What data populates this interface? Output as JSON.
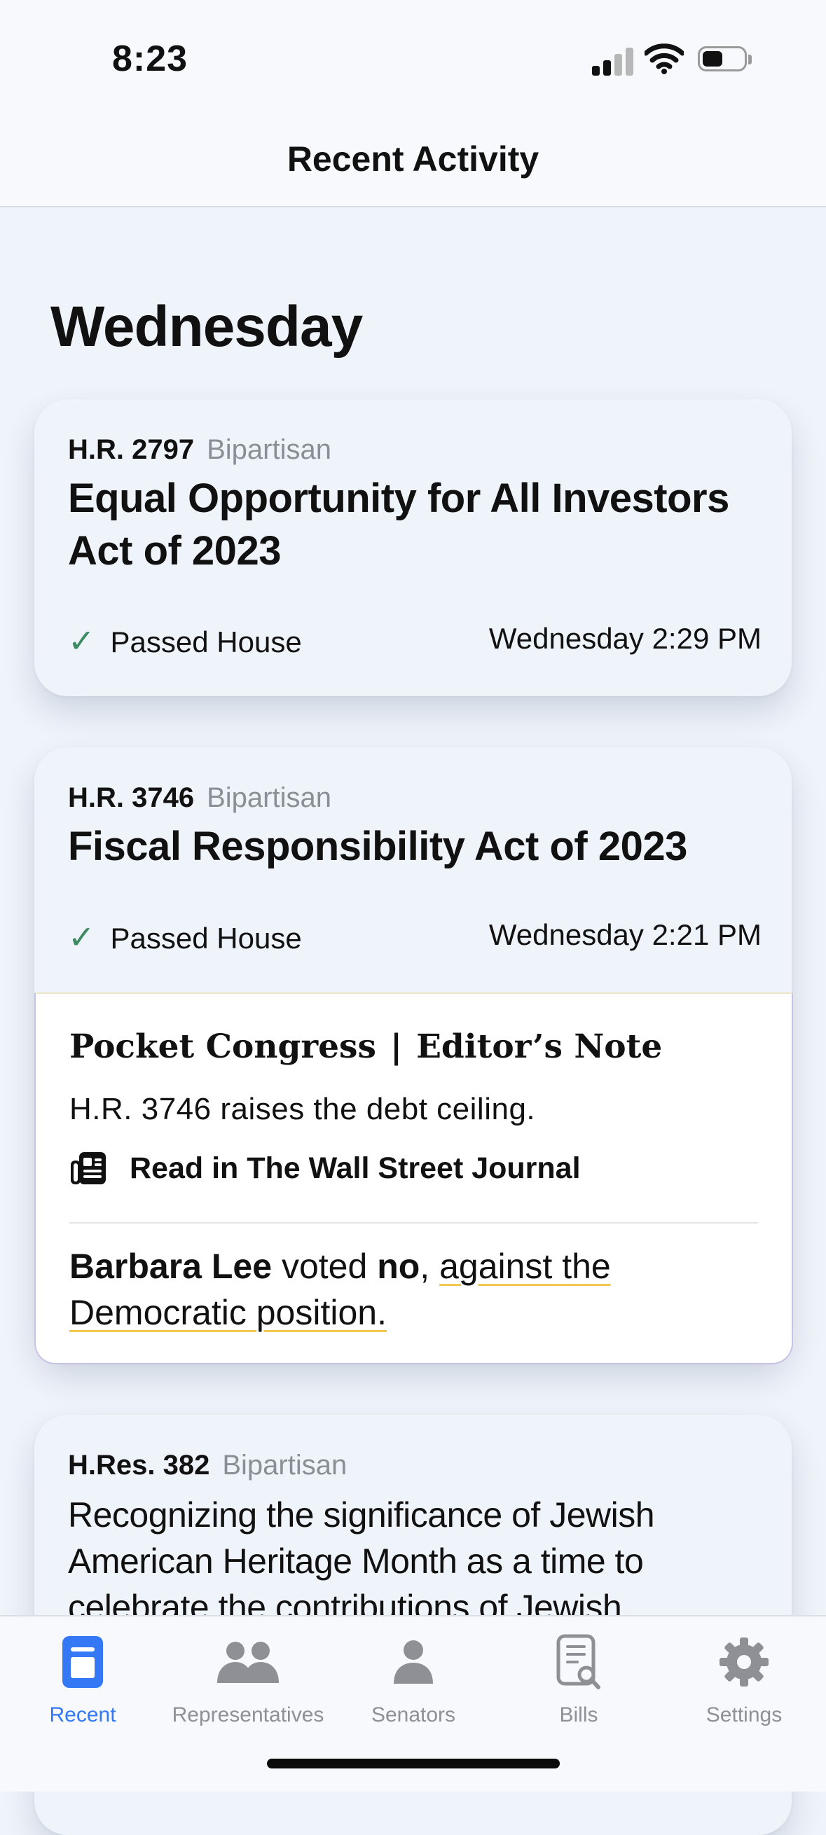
{
  "status_bar": {
    "time": "8:23"
  },
  "nav": {
    "title": "Recent Activity"
  },
  "feed": {
    "day_heading": "Wednesday",
    "cards": [
      {
        "bill_number": "H.R. 2797",
        "tag": "Bipartisan",
        "title": "Equal Opportunity for All Investors Act of 2023",
        "status": "Passed House",
        "timestamp": "Wednesday 2:29 PM"
      },
      {
        "bill_number": "H.R. 3746",
        "tag": "Bipartisan",
        "title": "Fiscal Responsibility Act of 2023",
        "status": "Passed House",
        "timestamp": "Wednesday 2:21 PM",
        "editor_note": {
          "brand": "Pocket Congress",
          "separator": "|",
          "label": "Editor’s Note",
          "body": "H.R. 3746 raises the debt ceiling.",
          "link": "Read in The Wall Street Journal",
          "vote": {
            "name": "Barbara Lee",
            "verb": "voted",
            "vote": "no",
            "comma": ",",
            "context": "against the Democratic position."
          }
        }
      },
      {
        "bill_number": "H.Res. 382",
        "tag": "Bipartisan",
        "title": "Recognizing the significance of Jewish American Heritage Month as a time to celebrate the contributions of Jewish"
      }
    ]
  },
  "tabs": [
    {
      "label": "Recent",
      "icon": "recent-icon",
      "active": true
    },
    {
      "label": "Representatives",
      "icon": "people-icon",
      "active": false
    },
    {
      "label": "Senators",
      "icon": "person-icon",
      "active": false
    },
    {
      "label": "Bills",
      "icon": "bill-search-icon",
      "active": false
    },
    {
      "label": "Settings",
      "icon": "gear-icon",
      "active": false
    }
  ],
  "colors": {
    "accent": "#3478f6",
    "check": "#3d8a63",
    "underline": "#f2c94c",
    "background": "#eff3fa"
  }
}
